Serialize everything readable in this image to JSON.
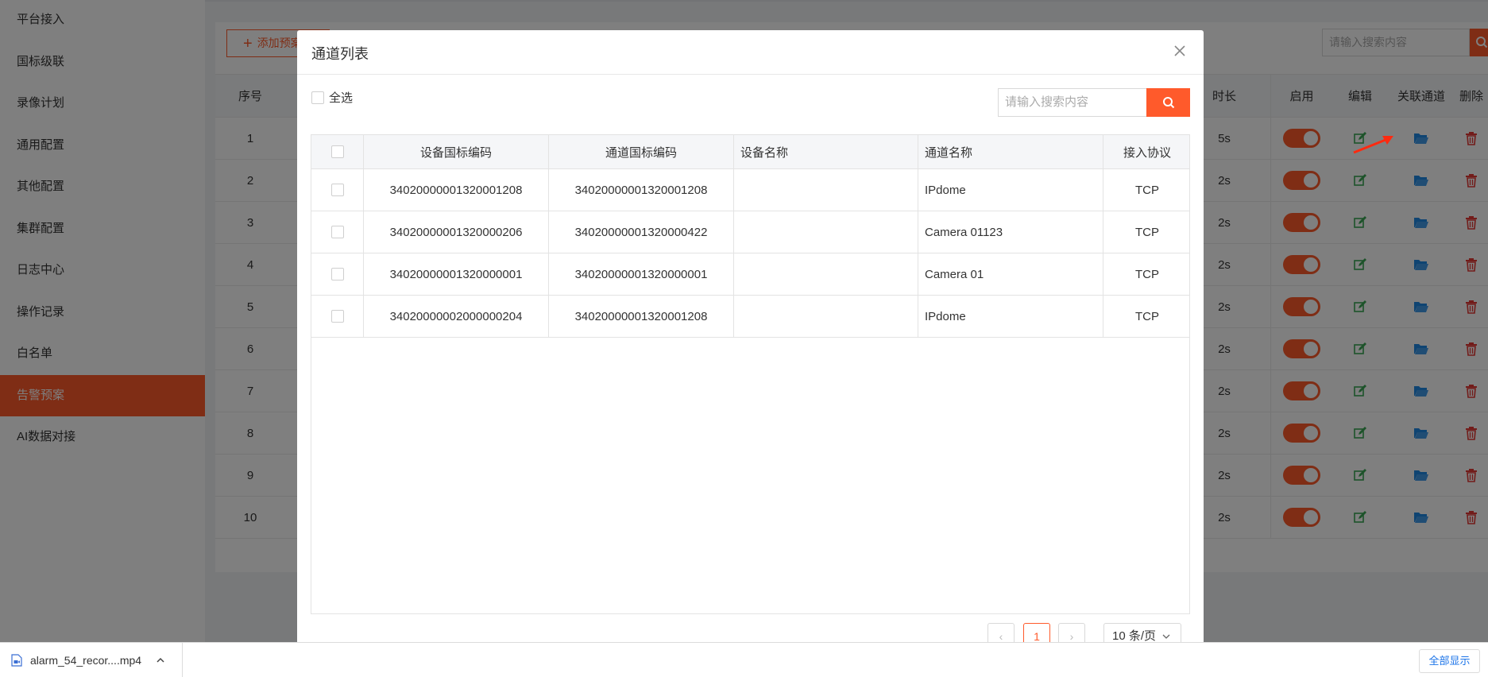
{
  "sidebar": {
    "items": [
      {
        "label": "平台接入"
      },
      {
        "label": "国标级联"
      },
      {
        "label": "录像计划"
      },
      {
        "label": "通用配置"
      },
      {
        "label": "其他配置"
      },
      {
        "label": "集群配置"
      },
      {
        "label": "日志中心"
      },
      {
        "label": "操作记录"
      },
      {
        "label": "白名单"
      },
      {
        "label": "告警预案",
        "active": true
      },
      {
        "label": "AI数据对接"
      }
    ]
  },
  "background": {
    "add_button_label": "添加预案",
    "search_placeholder": "请输入搜索内容",
    "columns": {
      "index": "序号",
      "duration": "时长",
      "enable": "启用",
      "edit": "编辑",
      "link_channel": "关联通道",
      "delete": "删除"
    },
    "rows": [
      {
        "index": "1",
        "duration": "5s"
      },
      {
        "index": "2",
        "duration": "2s"
      },
      {
        "index": "3",
        "duration": "2s"
      },
      {
        "index": "4",
        "duration": "2s"
      },
      {
        "index": "5",
        "duration": "2s"
      },
      {
        "index": "6",
        "duration": "2s"
      },
      {
        "index": "7",
        "duration": "2s"
      },
      {
        "index": "8",
        "duration": "2s"
      },
      {
        "index": "9",
        "duration": "2s"
      },
      {
        "index": "10",
        "duration": "2s"
      }
    ]
  },
  "modal": {
    "title": "通道列表",
    "select_all_label": "全选",
    "search_placeholder": "请输入搜索内容",
    "columns": {
      "device_gb_code": "设备国标编码",
      "channel_gb_code": "通道国标编码",
      "device_name": "设备名称",
      "channel_name": "通道名称",
      "protocol": "接入协议"
    },
    "rows": [
      {
        "device_gb_code": "34020000001320001208",
        "channel_gb_code": "34020000001320001208",
        "device_name": "",
        "channel_name": "IPdome",
        "protocol": "TCP"
      },
      {
        "device_gb_code": "34020000001320000206",
        "channel_gb_code": "34020000001320000422",
        "device_name": "",
        "channel_name": "Camera 01123",
        "protocol": "TCP"
      },
      {
        "device_gb_code": "34020000001320000001",
        "channel_gb_code": "34020000001320000001",
        "device_name": "",
        "channel_name": "Camera 01",
        "protocol": "TCP"
      },
      {
        "device_gb_code": "34020000002000000204",
        "channel_gb_code": "34020000001320001208",
        "device_name": "",
        "channel_name": "IPdome",
        "protocol": "TCP"
      }
    ],
    "pagination": {
      "prev": "‹",
      "current_page": "1",
      "next": "›",
      "page_size": "10 条/页"
    }
  },
  "download_bar": {
    "file_name": "alarm_54_recor....mp4",
    "show_all_label": "全部显示"
  },
  "colors": {
    "accent": "#ff5a2b",
    "edit_icon": "#3aa655",
    "folder_icon": "#1e88e5",
    "delete_icon": "#e53935"
  }
}
